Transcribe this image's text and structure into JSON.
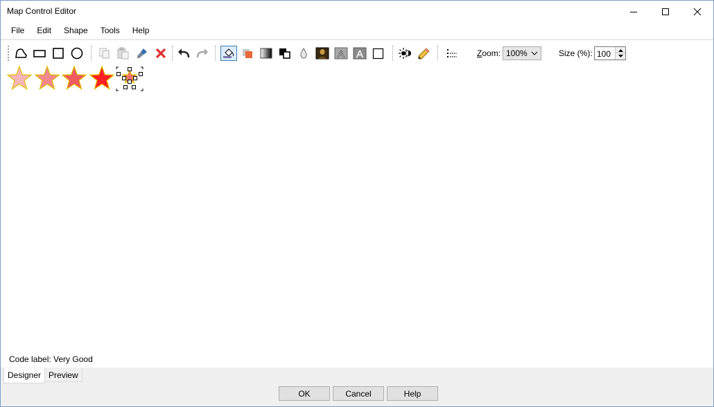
{
  "window": {
    "title": "Map Control Editor"
  },
  "menu": {
    "items": [
      "File",
      "Edit",
      "Shape",
      "Tools",
      "Help"
    ]
  },
  "toolbar": {
    "zoom_label_access": "Z",
    "zoom_label_rest": "oom:",
    "zoom_value": "100%",
    "size_label": "Size (%):",
    "size_value": "100"
  },
  "canvas": {
    "code_label": "Code label: Very Good",
    "stars": [
      {
        "fill": "#f4b6b8",
        "stroke": "#e0c000"
      },
      {
        "fill": "#f0888c",
        "stroke": "#e0c000"
      },
      {
        "fill": "#ee5a5e",
        "stroke": "#e0c000"
      },
      {
        "fill": "#ff2020",
        "stroke": "#e0c000"
      },
      {
        "fill": "#ee7070",
        "stroke": "#e0c000",
        "selected": true
      }
    ]
  },
  "tabs": [
    {
      "label": "Designer",
      "active": true
    },
    {
      "label": "Preview",
      "active": false
    }
  ],
  "footer": {
    "ok": "OK",
    "cancel": "Cancel",
    "help": "Help"
  }
}
